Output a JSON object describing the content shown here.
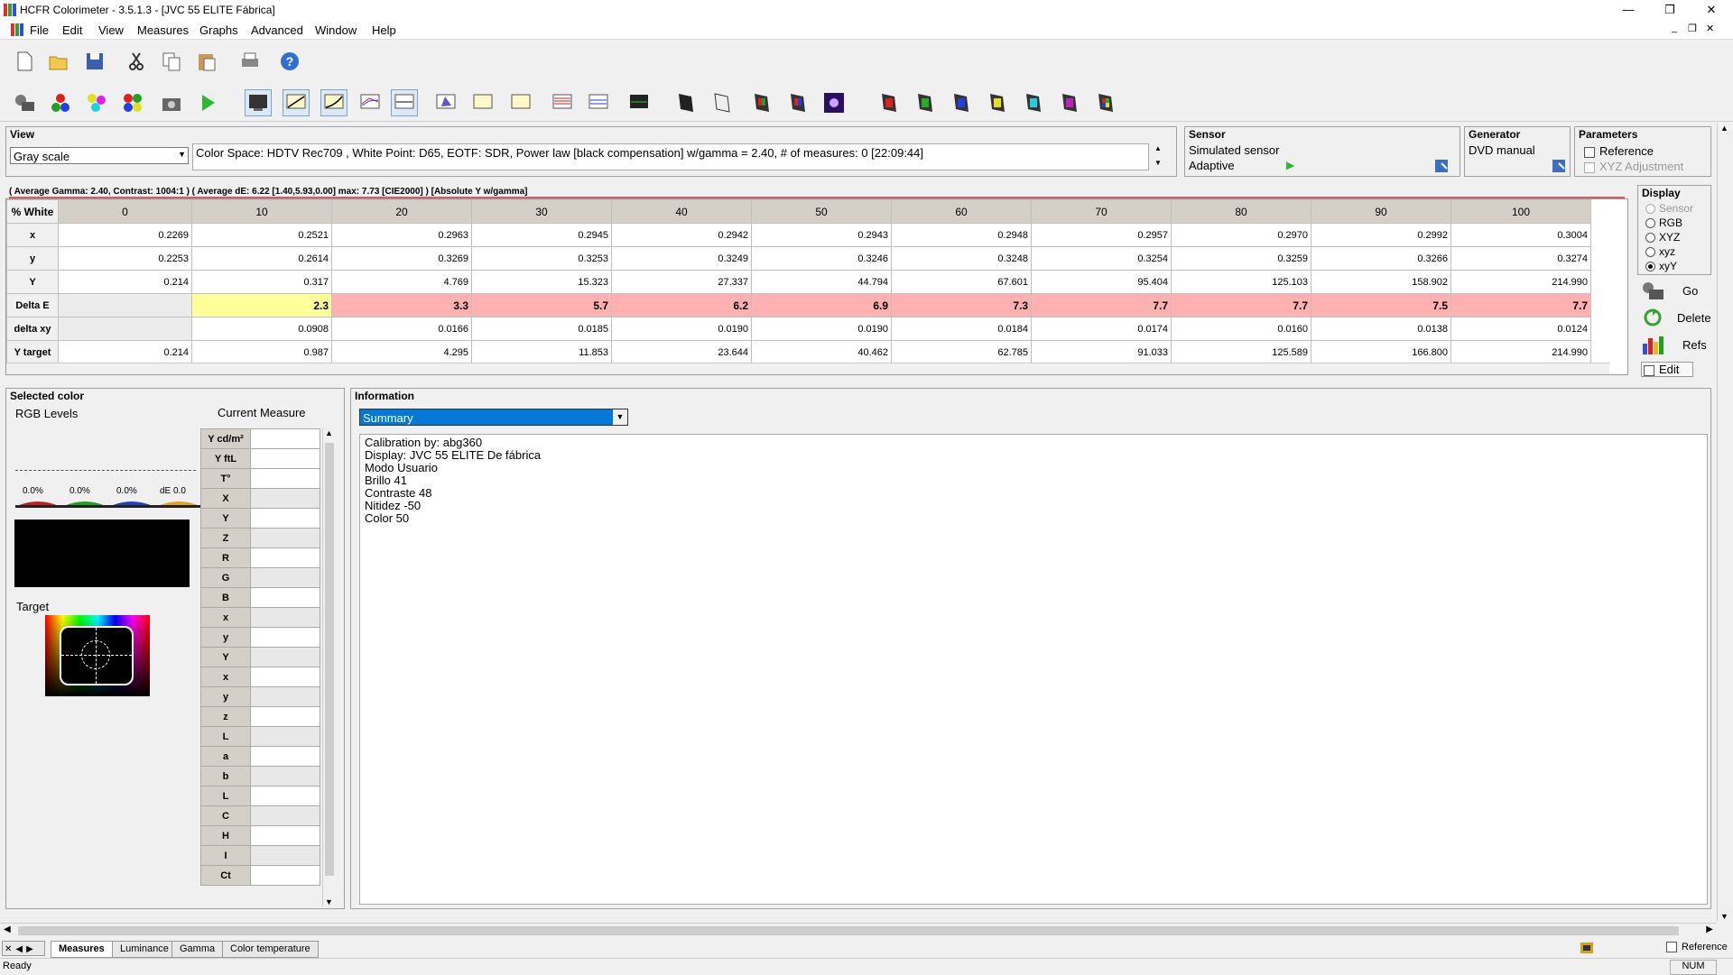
{
  "window": {
    "title": "HCFR Colorimeter - 3.5.1.3 - [JVC 55 ELITE Fábrica]",
    "min": "—",
    "max": "❐",
    "close": "✕"
  },
  "menu": {
    "items": [
      "File",
      "Edit",
      "View",
      "Measures",
      "Graphs",
      "Advanced",
      "Window",
      "Help"
    ],
    "mdi_min": "_",
    "mdi_restore": "❐",
    "mdi_close": "✕"
  },
  "view_panel": {
    "title": "View",
    "selected_mode": "Gray scale",
    "info": "Color Space: HDTV Rec709 , White Point: D65, EOTF:  SDR, Power law [black compensation] w/gamma = 2.40, # of measures: 0 [22:09:44]"
  },
  "sensor_panel": {
    "title": "Sensor",
    "name": "Simulated sensor",
    "mode": "Adaptive"
  },
  "generator_panel": {
    "title": "Generator",
    "name": "DVD manual"
  },
  "parameters_panel": {
    "title": "Parameters",
    "reference": "Reference",
    "xyz_adjustment": "XYZ Adjustment"
  },
  "summary_line": "( Average Gamma: 2.40, Contrast: 1004:1 ) ( Average dE: 6.22 [1.40,5.93,0.00] max: 7.73 [CIE2000] ) [Absolute Y w/gamma]",
  "grid": {
    "corner": "% White",
    "columns": [
      "0",
      "10",
      "20",
      "30",
      "40",
      "50",
      "60",
      "70",
      "80",
      "90",
      "100"
    ],
    "rows": [
      {
        "label": "x",
        "cls": "",
        "values": [
          "0.2269",
          "0.2521",
          "0.2963",
          "0.2945",
          "0.2942",
          "0.2943",
          "0.2948",
          "0.2957",
          "0.2970",
          "0.2992",
          "0.3004"
        ]
      },
      {
        "label": "y",
        "cls": "",
        "values": [
          "0.2253",
          "0.2614",
          "0.3269",
          "0.3253",
          "0.3249",
          "0.3246",
          "0.3248",
          "0.3254",
          "0.3259",
          "0.3266",
          "0.3274"
        ]
      },
      {
        "label": "Y",
        "cls": "",
        "values": [
          "0.214",
          "0.317",
          "4.769",
          "15.323",
          "27.337",
          "44.794",
          "67.601",
          "95.404",
          "125.103",
          "158.902",
          "214.990"
        ]
      },
      {
        "label": "Delta E",
        "cls": "de",
        "values": [
          "",
          "2.3",
          "3.3",
          "5.7",
          "6.2",
          "6.9",
          "7.3",
          "7.7",
          "7.7",
          "7.5",
          "7.7"
        ]
      },
      {
        "label": "delta xy",
        "cls": "dxy",
        "values": [
          "",
          "0.0908",
          "0.0166",
          "0.0185",
          "0.0190",
          "0.0190",
          "0.0184",
          "0.0174",
          "0.0160",
          "0.0138",
          "0.0124"
        ]
      },
      {
        "label": "Y target",
        "cls": "",
        "values": [
          "0.214",
          "0.987",
          "4.295",
          "11.853",
          "23.644",
          "40.462",
          "62.785",
          "91.033",
          "125.589",
          "166.800",
          "214.990"
        ]
      }
    ]
  },
  "display_panel": {
    "title": "Display",
    "options": [
      "Sensor",
      "RGB",
      "XYZ",
      "xyz",
      "xyY"
    ],
    "selected": "xyY",
    "go": "Go",
    "delete": "Delete",
    "refs": "Refs",
    "edit": "Edit"
  },
  "selected_color": {
    "title": "Selected color",
    "rgb_levels": "RGB Levels",
    "current_measure": "Current Measure",
    "levels": [
      "0.0%",
      "0.0%",
      "0.0%",
      "dE 0.0"
    ],
    "target": "Target",
    "measure_labels": [
      "Y cd/m²",
      "Y ftL",
      "T°",
      "X",
      "Y",
      "Z",
      "R",
      "G",
      "B",
      "x",
      "y",
      "Y",
      "x",
      "y",
      "z",
      "L",
      "a",
      "b",
      "L",
      "C",
      "H",
      "I",
      "Ct"
    ]
  },
  "information": {
    "title": "Information",
    "dropdown": "Summary",
    "lines": [
      "Calibration by: abg360",
      "Display: JVC 55 ELITE De fábrica",
      "Modo Usuario",
      "Brillo 41",
      "Contraste 48",
      "Nitidez -50",
      "Color 50"
    ]
  },
  "tabs": {
    "items": [
      "Measures",
      "Luminance",
      "Gamma",
      "Color temperature"
    ],
    "active": "Measures",
    "reference": "Reference"
  },
  "status": {
    "text": "Ready",
    "num": "NUM"
  },
  "colors": {
    "delta_e_bad": "#ffb0b0",
    "delta_e_ok": "#ffff99",
    "selection": "#0078d7"
  }
}
